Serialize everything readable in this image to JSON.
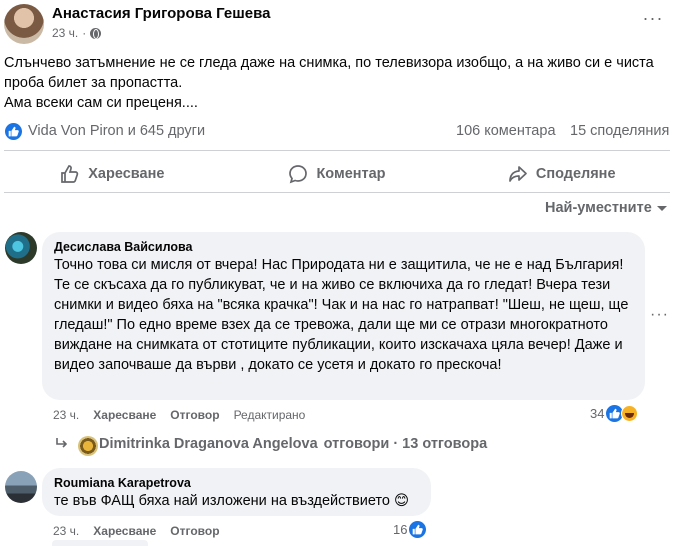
{
  "post": {
    "author": "Анастасия Григорова Гешева",
    "time": "23 ч.",
    "more_label": "···",
    "text_line1": "Слънчево затъмнение не се гледа даже на снимка, по телевизора изобщо, а на живо си е чиста проба билет за пропастта.",
    "text_line2": "Ама всеки сам си преценя...."
  },
  "stats": {
    "reactors": "Vida Von Piron и 645 други",
    "comments": "106 коментара",
    "shares": "15 споделяния"
  },
  "actions": {
    "like": "Харесване",
    "comment": "Коментар",
    "share": "Споделяне"
  },
  "sort": {
    "label": "Най-уместните"
  },
  "comments": [
    {
      "author": "Десислава Вайсилова",
      "text": "Точно това си мисля от вчера! Нас Природата ни е защитила, че не е над България! Те се скъсаха да го публикуват, че и на живо се включиха да го гледат! Вчера тези снимки и видео бяха на \"всяка крачка\"! Чак и на нас го натрапват! \"Шеш, не щеш, ще гледаш!\" По едно време взех да се тревожа, дали ще ми се отрази многократното виждане на снимката от стотиците публикации, които изскачаха цяла вечер! Даже и видео започваше да върви , докато се усетя и докато го прескоча!",
      "time": "23 ч.",
      "like": "Харесване",
      "reply": "Отговор",
      "edited": "Редактирано",
      "reactions": "34"
    },
    {
      "author": "Roumiana Karapetrova",
      "text": "те във ФАЩ бяха най изложени на въздействието 😊",
      "time": "23 ч.",
      "like": "Харесване",
      "reply": "Отговор",
      "reactions": "16"
    }
  ],
  "replies": {
    "name": "Dimitrinka Draganova Angelova",
    "label": "отговори · 13 отговора"
  },
  "colors": {
    "accent": "#1b74e4",
    "secondary_text": "#65676b",
    "bubble": "#f0f2f5"
  }
}
